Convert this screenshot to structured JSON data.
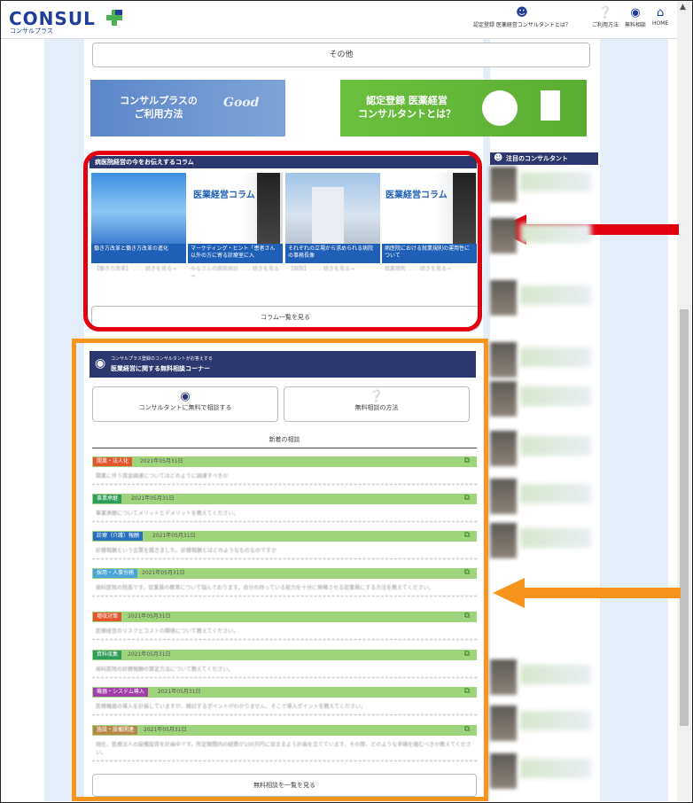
{
  "header": {
    "logo": "CONSUL",
    "logo_sub": "コンサルプラス",
    "nav": [
      {
        "label": "認定登録 医薬経営コンサルタントとは？",
        "icon": "person-icon"
      },
      {
        "label": "ご利用方法",
        "icon": "question-icon"
      },
      {
        "label": "無料相談",
        "icon": "chat-icon"
      },
      {
        "label": "HOME",
        "icon": "home-icon"
      }
    ]
  },
  "top_button": "その他",
  "banners": {
    "left_line1": "コンサルプラスの",
    "left_line2": "ご利用方法",
    "left_deco": "Good",
    "right_line1": "認定登録 医薬経営",
    "right_line2": "コンサルタントとは？"
  },
  "column_section": {
    "title": "病医院経営の今をお伝えするコラム",
    "cards": [
      {
        "caption": "働き方改革と働き方改革の進化",
        "image_label": "",
        "desc": "【働き方改革】 …… 続きを見る→",
        "more": "続きを見る→"
      },
      {
        "caption": "マーケティング・ヒント「患者さん以外の方に寄る診療室に入",
        "image_label": "医業経営コラム",
        "desc": "みなさんの病院探訪 …… 続きを見る→",
        "more": "続きを見る→"
      },
      {
        "caption": "それぞれの立場から求められる病院の事務長像",
        "image_label": "",
        "desc": "【病院】 …… 続きを見る→",
        "more": "続きを見る→"
      },
      {
        "caption": "病医院における就業規則の運用性について",
        "image_label": "医業経営コラム",
        "desc": "就業規則 …… 続きを見る→",
        "more": "続きを見る→"
      }
    ],
    "all_button": "コラム一覧を見る"
  },
  "right_column": {
    "title": "注目のコンサルタント"
  },
  "consult_section": {
    "sub": "コンサルプラス登録のコンサルタントがお答えする",
    "title": "医業経営に関する無料相談コーナー",
    "btn_consult": "コンサルタントに無料で相談する",
    "btn_method": "無料相談の方法",
    "latest": "新着の相談",
    "items": [
      {
        "tag": "開業・法人化",
        "color": "#e4572e",
        "date": "2021年05月31日",
        "q": "開業に伴う資金調達についてはどのように調達すべきか"
      },
      {
        "tag": "事業承継",
        "color": "#2e9c5a",
        "date": "2021年05月31日",
        "q": "事業承継についてメリットとデメリットを教えてください。"
      },
      {
        "tag": "診療（介護）報酬",
        "color": "#2a6fbf",
        "date": "2021年05月31日",
        "q": "診療報酬という言葉を聞きました。診療報酬とはどのようなものなのですか"
      },
      {
        "tag": "採用・人事労務",
        "color": "#4aa6d8",
        "date": "2021年05月31日",
        "q": "歯科医院の院長です。従業員の教育について悩んでおります。自分の持っている能力を十分に発揮させる従業員にする方法を教えてください。"
      },
      {
        "tag": "増収対策",
        "color": "#e4572e",
        "date": "2021年05月31日",
        "q": "医療経営のリスクとコストの関係について教えてください。"
      },
      {
        "tag": "資料収集",
        "color": "#2e9c5a",
        "date": "2021年05月31日",
        "q": "歯科医院の診療報酬の算定方法について教えてください。"
      },
      {
        "tag": "機器・システム導入",
        "color": "#a33fa8",
        "date": "2021年05月31日",
        "q": "医療機器の導入を計画していますが、検討するポイントがわかりません。そこで導入ポイントを教えてください。"
      },
      {
        "tag": "施設・設備関連",
        "color": "#b8884a",
        "date": "2021年05月31日",
        "q": "現在、医療法人の設備投資を計画中です。所定期間内の経費が100万円に収まるよう計画を立てています。その際、どのような手順を踏むべきか教えてください。"
      }
    ],
    "all_button": "無料相談を一覧を見る"
  }
}
